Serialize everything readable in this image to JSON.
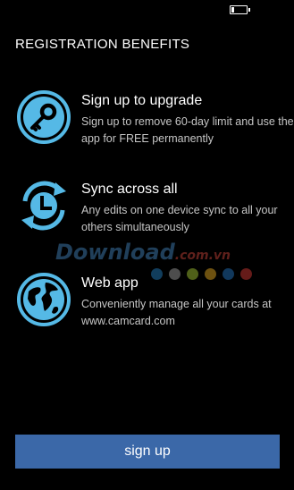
{
  "status_bar": {
    "battery_level": 0.15,
    "battery_icon": "battery-low-icon"
  },
  "header": {
    "title": "REGISTRATION BENEFITS"
  },
  "benefits": [
    {
      "icon": "key-icon",
      "title": "Sign up to upgrade",
      "description": "Sign up to remove 60-day limit and use the app for FREE permanently"
    },
    {
      "icon": "sync-clock-icon",
      "title": "Sync across all",
      "description": "Any edits on one device sync to all your others simultaneously"
    },
    {
      "icon": "globe-icon",
      "title": "Web app",
      "description": "Conveniently manage all your cards at www.camcard.com"
    }
  ],
  "watermark": {
    "text": "Download",
    "suffix": ".com.vn",
    "dot_colors": [
      "#1f6fa8",
      "#8c8c8c",
      "#8fae2e",
      "#c7941d",
      "#1f66a8",
      "#b8322e"
    ]
  },
  "footer": {
    "signup_label": "sign up"
  },
  "colors": {
    "icon_accent": "#55b9e6",
    "button_bg": "#3b68a8",
    "background": "#000000"
  }
}
